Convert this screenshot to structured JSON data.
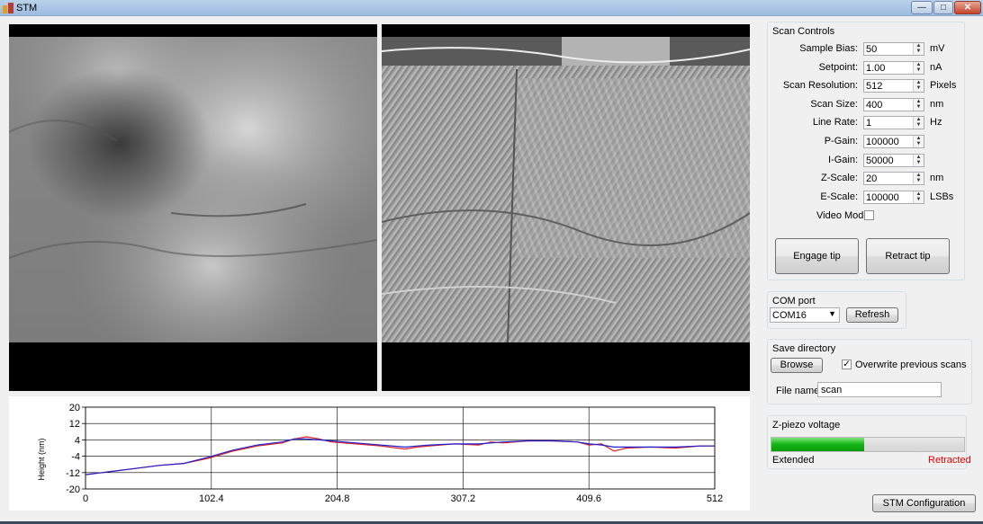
{
  "window": {
    "title": "STM",
    "min_glyph": "—",
    "max_glyph": "□",
    "close_glyph": "✕"
  },
  "scan_controls": {
    "title": "Scan Controls",
    "fields": [
      {
        "label": "Sample Bias:",
        "value": "50",
        "unit": "mV"
      },
      {
        "label": "Setpoint:",
        "value": "1.00",
        "unit": "nA"
      },
      {
        "label": "Scan Resolution:",
        "value": "512",
        "unit": "Pixels"
      },
      {
        "label": "Scan Size:",
        "value": "400",
        "unit": "nm"
      },
      {
        "label": "Line Rate:",
        "value": "1",
        "unit": "Hz"
      },
      {
        "label": "P-Gain:",
        "value": "100000",
        "unit": ""
      },
      {
        "label": "I-Gain:",
        "value": "50000",
        "unit": ""
      },
      {
        "label": "Z-Scale:",
        "value": "20",
        "unit": "nm"
      },
      {
        "label": "E-Scale:",
        "value": "100000",
        "unit": "LSBs"
      }
    ],
    "video_mode_label": "Video Mode",
    "video_mode_checked": false,
    "engage_label": "Engage tip",
    "retract_label": "Retract tip"
  },
  "com_port": {
    "title": "COM port",
    "selected": "COM16",
    "refresh_label": "Refresh"
  },
  "save_directory": {
    "title": "Save directory",
    "browse_label": "Browse",
    "overwrite_label": "Overwrite previous scans",
    "overwrite_checked": true,
    "filename_label": "File name:",
    "filename_value": "scan"
  },
  "zpiezo": {
    "title": "Z-piezo voltage",
    "level": 0.48,
    "extended_label": "Extended",
    "retracted_label": "Retracted",
    "retracted_color": "#e00000"
  },
  "stm_config_label": "STM Configuration",
  "chart_data": {
    "type": "line",
    "ylabel": "Height (nm)",
    "xlim": [
      0,
      512
    ],
    "ylim": [
      -20,
      20
    ],
    "xticks": [
      "0",
      "102.4",
      "204.8",
      "307.2",
      "409.6",
      "512"
    ],
    "yticks": [
      "20",
      "12",
      "4",
      "-4",
      "-12",
      "-20"
    ],
    "grid": true,
    "series": [
      {
        "color": "#e02020",
        "x": [
          0,
          20,
          40,
          60,
          80,
          100,
          120,
          140,
          160,
          170,
          180,
          190,
          200,
          220,
          240,
          260,
          270,
          280,
          300,
          320,
          330,
          340,
          360,
          380,
          400,
          410,
          420,
          430,
          440,
          460,
          480,
          500,
          512
        ],
        "y": [
          -13,
          -11.5,
          -10,
          -8.5,
          -7.5,
          -5,
          -1.5,
          1,
          2.5,
          4.5,
          5.5,
          4.5,
          3,
          2,
          1,
          -0.5,
          0.5,
          1,
          2,
          1.5,
          3,
          2.5,
          3.5,
          3.5,
          3,
          1.5,
          2,
          -1.5,
          0,
          0.5,
          0,
          1,
          1
        ]
      },
      {
        "color": "#2020d0",
        "x": [
          0,
          20,
          40,
          60,
          80,
          100,
          120,
          140,
          160,
          170,
          180,
          190,
          200,
          220,
          240,
          260,
          270,
          280,
          300,
          320,
          330,
          340,
          360,
          380,
          400,
          410,
          420,
          430,
          440,
          460,
          480,
          500,
          512
        ],
        "y": [
          -13,
          -11.5,
          -10,
          -8.5,
          -7.5,
          -4.5,
          -1,
          1.5,
          3,
          4.5,
          4.5,
          4,
          3.5,
          2.5,
          1.5,
          0.5,
          1,
          1.5,
          2,
          2,
          2.5,
          3,
          3.5,
          3.5,
          3,
          2,
          1.5,
          0.5,
          0.5,
          0.5,
          0.5,
          1,
          1
        ]
      }
    ]
  }
}
